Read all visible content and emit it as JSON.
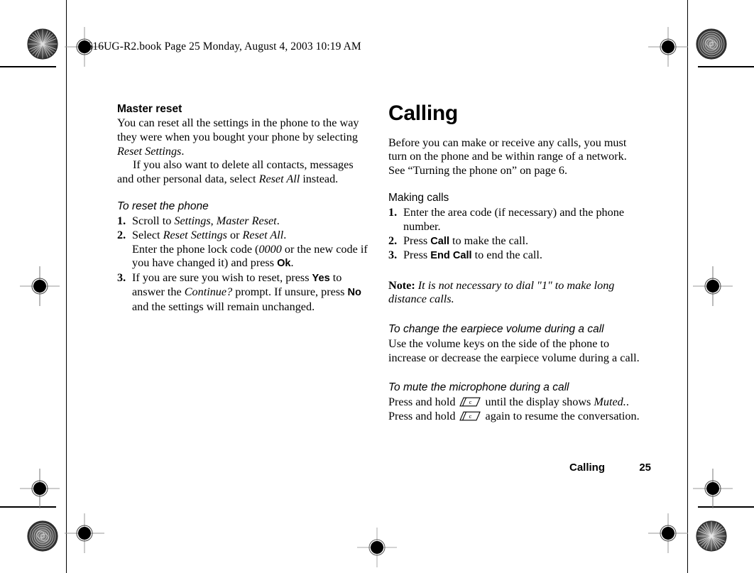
{
  "print_header": "T616UG-R2.book  Page 25  Monday, August 4, 2003  10:19 AM",
  "left_column": {
    "section_title": "Master reset",
    "intro_p1_a": "You can reset all the settings in the phone to the way they were when you bought your phone by selecting ",
    "intro_p1_italic": "Reset Settings",
    "intro_p1_b": ".",
    "intro_p2_a": "If you also want to delete all contacts, messages and other personal data, select ",
    "intro_p2_italic": "Reset All",
    "intro_p2_b": " instead.",
    "procedure_title": "To reset the phone",
    "steps": [
      {
        "num": "1.",
        "a": "Scroll to ",
        "i1": "Settings",
        "b": ", ",
        "i2": "Master Reset",
        "c": "."
      },
      {
        "num": "2.",
        "a": "Select ",
        "i1": "Reset Settings",
        "b": " or ",
        "i2": "Reset All",
        "c": ".",
        "d": "Enter the phone lock code (",
        "i3": "0000",
        "e": " or the new code if you have changed it) and press ",
        "key": "Ok",
        "f": "."
      },
      {
        "num": "3.",
        "a": "If you are sure you wish to reset, press ",
        "key1": "Yes",
        "b": " to answer the ",
        "i1": "Continue?",
        "c": " prompt. If unsure, press ",
        "key2": "No",
        "d": " and the settings will remain unchanged."
      }
    ]
  },
  "right_column": {
    "chapter_title": "Calling",
    "intro": "Before you can make or receive any calls, you must turn on the phone and be within range of a network. See “Turning the phone on” on page 6.",
    "making_calls_title": "Making calls",
    "making_calls_steps": [
      {
        "num": "1.",
        "text": "Enter the area code (if necessary) and the phone number."
      },
      {
        "num": "2.",
        "a": "Press ",
        "key": "Call",
        "b": " to make the call."
      },
      {
        "num": "3.",
        "a": "Press ",
        "key": "End Call",
        "b": " to end the call."
      }
    ],
    "note_label": "Note:",
    "note_text": " It is not necessary to dial \"1\" to make long distance calls.",
    "earpiece_title": "To change the earpiece volume during a call",
    "earpiece_text": "Use the volume keys on the side of the phone to increase or decrease the earpiece volume during a call.",
    "mute_title": "To mute the microphone during a call",
    "mute_line1_a": "Press and hold ",
    "mute_line1_b": " until the display shows ",
    "mute_line1_italic": "Muted.",
    "mute_line1_c": ".",
    "mute_line2_a": "Press and hold ",
    "mute_line2_b": " again to resume the conversation."
  },
  "footer": {
    "chapter": "Calling",
    "page_number": "25"
  },
  "icons": {
    "clear_key": "clear-key-icon",
    "registration_mark": "registration-target-icon",
    "color_rosette": "color-rosette-icon"
  }
}
